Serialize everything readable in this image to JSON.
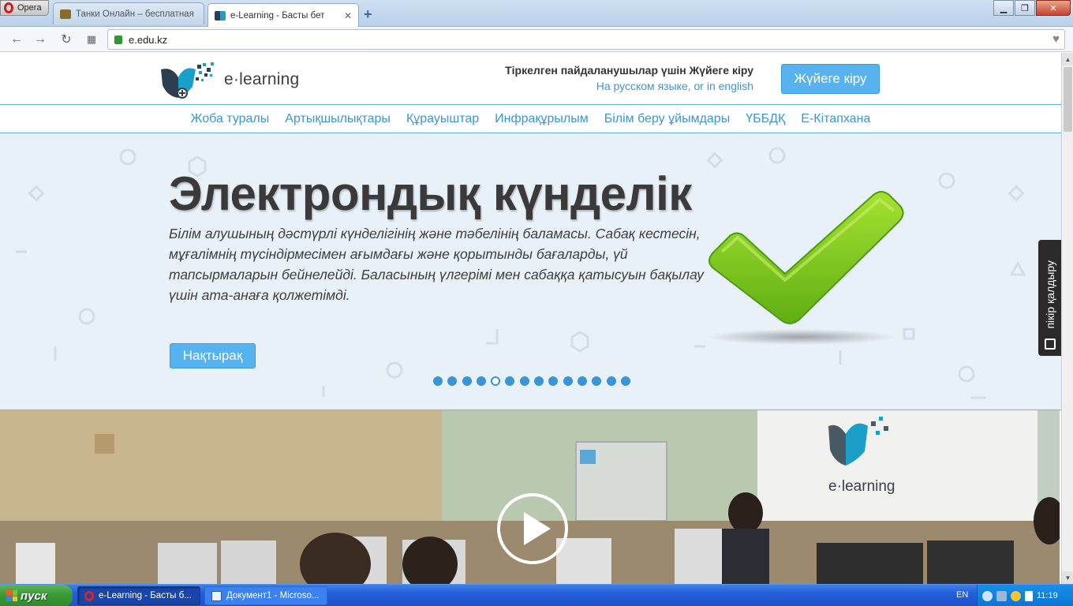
{
  "browser": {
    "menu_label": "Opera",
    "tabs": [
      {
        "label": "Танки Онлайн – бесплатная",
        "active": false
      },
      {
        "label": "e-Learning - Басты бет",
        "active": true
      }
    ],
    "new_tab": "+",
    "url": "e.edu.kz"
  },
  "header": {
    "logo_text": "e·learning",
    "login_title": "Тіркелген пайдаланушылар үшін Жүйеге кіру",
    "lang_ru": "На русском языке",
    "lang_sep": ", ",
    "lang_en": "or in english",
    "login_button": "Жүйеге кіру"
  },
  "menu": {
    "items": [
      {
        "label": "Жоба туралы"
      },
      {
        "label": "Артықшылықтары"
      },
      {
        "label": "Құрауыштар"
      },
      {
        "label": "Инфрақұрылым"
      },
      {
        "label": "Білім беру ұйымдары"
      },
      {
        "label": "ҮББДҚ"
      },
      {
        "label": "Е-Кітапхана"
      }
    ]
  },
  "hero": {
    "title": "Электрондық күнделік",
    "description": "Білім алушының дәстүрлі күнделігінің және тәбелінің баламасы. Сабақ кестесін, мұғалімнің түсіндірмесімен ағымдағы және қорытынды бағаларды, үй тапсырмаларын бейнелейді. Баласының үлгерімі мен сабаққа қатысуын бақылау үшін ата-анаға қолжетімді.",
    "more_button": "Нақтырақ",
    "slide_count": 14,
    "current_slide": 5
  },
  "feedback": {
    "label": "пікір қалдыру"
  },
  "video": {
    "logo_text": "e·learning"
  },
  "taskbar": {
    "start_label": "пуск",
    "tasks": [
      {
        "label": "e-Learning - Басты б..."
      },
      {
        "label": "Документ1 - Microso..."
      }
    ],
    "lang": "EN",
    "clock": "11:19"
  },
  "colors": {
    "accent": "#57b3f0",
    "link": "#3c95d4",
    "hero_bg": "#e9f1f8",
    "check_green": "#7dc61e"
  }
}
